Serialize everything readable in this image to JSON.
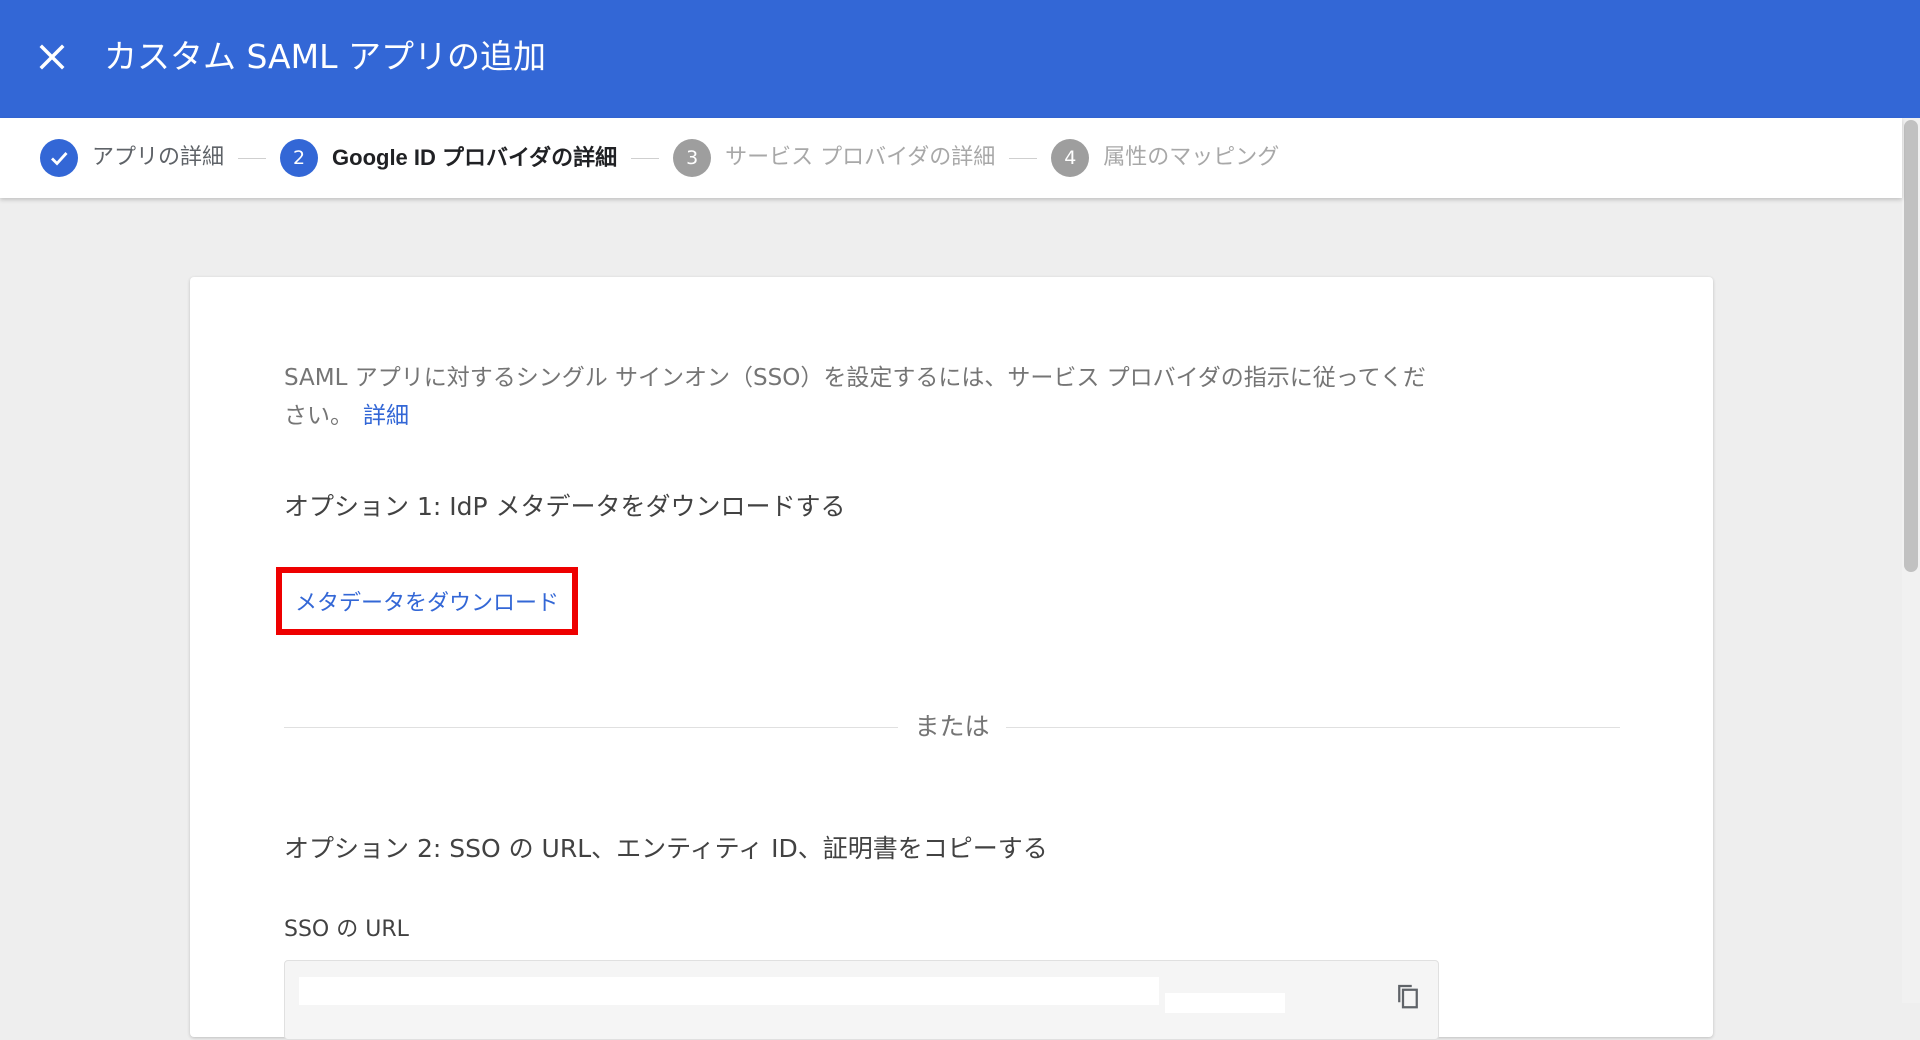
{
  "header": {
    "title": "カスタム SAML アプリの追加",
    "color": "#3367d6"
  },
  "stepper": {
    "steps": [
      {
        "number": "",
        "label": "アプリの詳細",
        "state": "done"
      },
      {
        "number": "2",
        "label": "Google ID プロバイダの詳細",
        "state": "active"
      },
      {
        "number": "3",
        "label": "サービス プロバイダの詳細",
        "state": "pending"
      },
      {
        "number": "4",
        "label": "属性のマッピング",
        "state": "pending"
      }
    ]
  },
  "main": {
    "intro": "SAML アプリに対するシングル サインオン（SSO）を設定するには、サービス プロバイダの指示に従ってください。",
    "intro_link": "詳細",
    "option1": {
      "heading": "オプション 1: IdP メタデータをダウンロードする",
      "button": "メタデータをダウンロード"
    },
    "divider": "または",
    "option2": {
      "heading": "オプション 2: SSO の URL、エンティティ ID、証明書をコピーする",
      "sso_url_label": "SSO の URL",
      "sso_url_value": ""
    }
  },
  "colors": {
    "accent": "#3367d6",
    "highlight_border": "#ee0000",
    "pending": "#9e9e9e"
  }
}
